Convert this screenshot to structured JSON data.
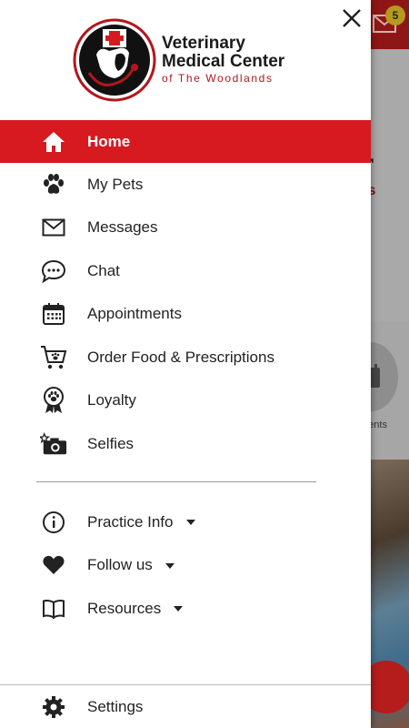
{
  "background": {
    "notification_count": "5",
    "hero_line1": "r",
    "hero_line2": "ls",
    "appointments_label": "ments"
  },
  "drawer": {
    "logo": {
      "line1": "Veterinary",
      "line2": "Medical Center",
      "line3": "of The Woodlands"
    },
    "primary_items": [
      {
        "label": "Home",
        "icon": "home-icon",
        "active": true
      },
      {
        "label": "My Pets",
        "icon": "paw-icon"
      },
      {
        "label": "Messages",
        "icon": "envelope-icon"
      },
      {
        "label": "Chat",
        "icon": "chat-bubble-icon"
      },
      {
        "label": "Appointments",
        "icon": "calendar-icon"
      },
      {
        "label": "Order Food & Prescriptions",
        "icon": "cart-icon"
      },
      {
        "label": "Loyalty",
        "icon": "award-ribbon-icon"
      },
      {
        "label": "Selfies",
        "icon": "camera-icon"
      }
    ],
    "secondary_items": [
      {
        "label": "Practice Info",
        "icon": "info-icon",
        "expandable": true
      },
      {
        "label": "Follow us",
        "icon": "heart-icon",
        "expandable": true
      },
      {
        "label": "Resources",
        "icon": "book-icon",
        "expandable": true
      }
    ],
    "settings": {
      "label": "Settings",
      "icon": "gear-icon"
    }
  },
  "colors": {
    "accent": "#d71920",
    "brand_red": "#b3161c",
    "text": "#222222"
  }
}
